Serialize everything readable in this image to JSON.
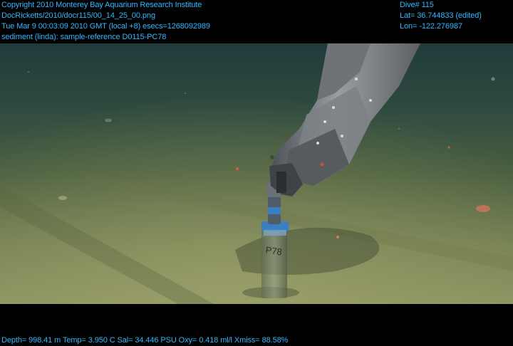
{
  "overlay": {
    "header_left": [
      "Copyright 2010 Monterey Bay Aquarium Research Institute",
      "DocRicketts/2010/docr115/00_14_25_00.png",
      "Tue Mar  9 00:03:09 2010 GMT (local +8)  esecs=1268092989",
      "sediment (linda): sample-reference D0115-PC78"
    ],
    "header_right": [
      "Dive# 115",
      "Lat= 36.744833 (edited)",
      "Lon= -122.276987"
    ],
    "footer": "Depth= 998.41 m  Temp= 3.950 C  Sal= 34.446 PSU  Oxy= 0.418 ml/l  Xmiss= 88.58%"
  },
  "colors": {
    "overlay_text": "#33b8ff",
    "letterbox": "#000000",
    "water_top": "#1f3b3a",
    "seafloor_far": "#4a5e3f",
    "seafloor_near": "#8a9160",
    "arm_metal": "#8c8f93",
    "core_tube_band": "#3a7fc4"
  }
}
